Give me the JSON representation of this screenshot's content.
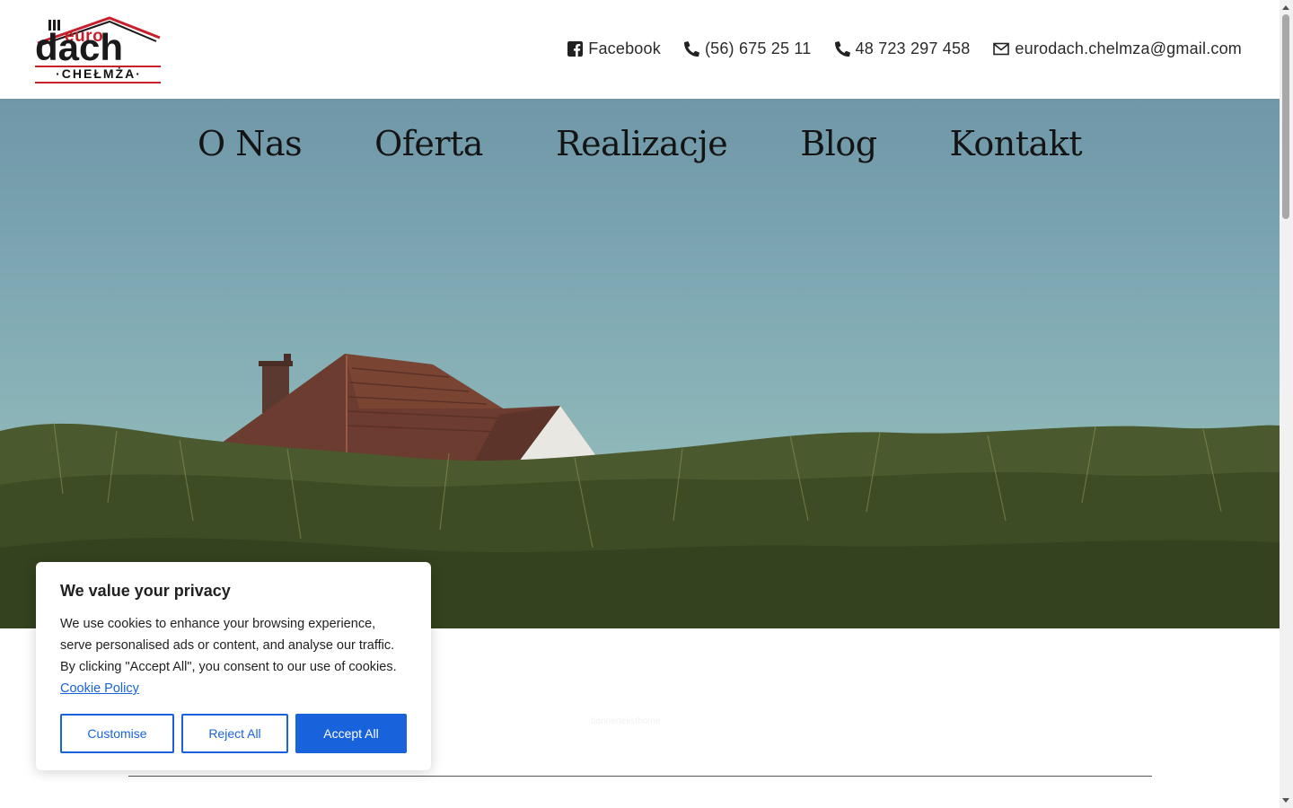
{
  "logo": {
    "top_text": "euro",
    "main_text": "dach",
    "sub_text": "·CHEŁMŻA·",
    "brand_red": "#c8202b"
  },
  "contacts": [
    {
      "icon": "facebook-square-icon",
      "label": "Facebook"
    },
    {
      "icon": "phone-icon",
      "label": "(56) 675 25 11"
    },
    {
      "icon": "phone-icon",
      "label": "48 723 297 458"
    },
    {
      "icon": "envelope-icon",
      "label": "eurodach.chelmza@gmail.com"
    }
  ],
  "nav": {
    "items": [
      "O Nas",
      "Oferta",
      "Realizacje",
      "Blog",
      "Kontakt"
    ]
  },
  "cookie_banner": {
    "title": "We value your privacy",
    "body": "We use cookies to enhance your browsing experience, serve personalised ads or content, and analyse our traffic. By clicking \"Accept All\", you consent to our use of cookies.",
    "policy_link": "Cookie Policy",
    "buttons": {
      "customise": "Customise",
      "reject": "Reject All",
      "accept": "Accept All"
    },
    "accent_color": "#1863dc"
  },
  "faint_text": "bannerteksthome"
}
